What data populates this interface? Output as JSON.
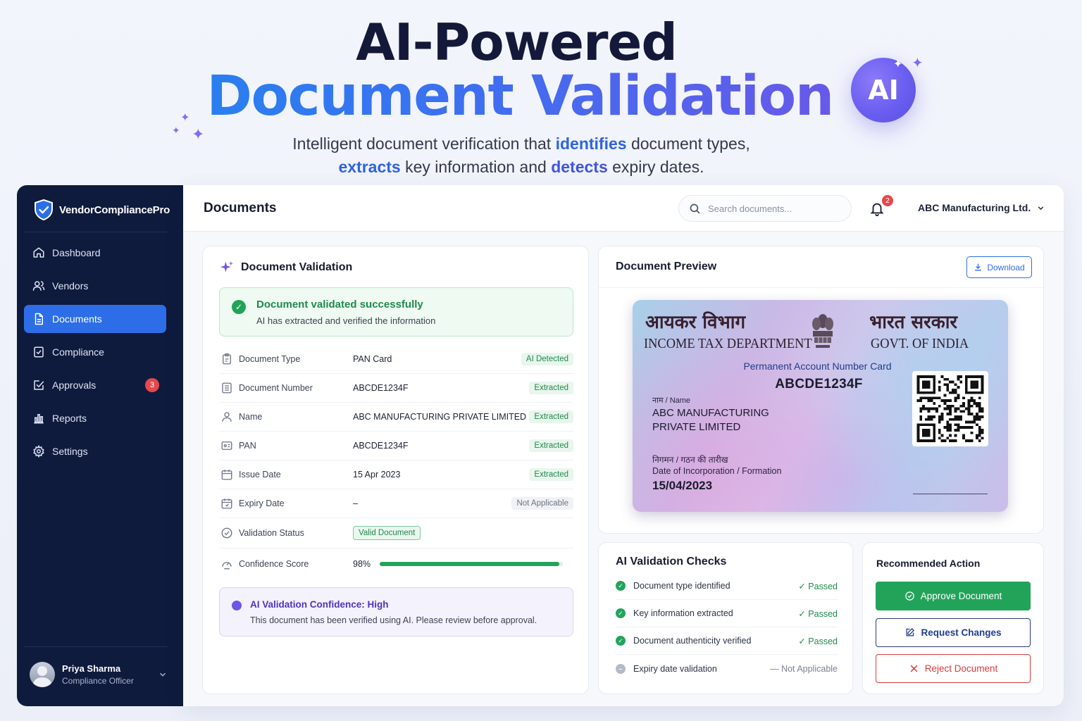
{
  "hero": {
    "title_line1": "AI-Powered",
    "title_line2": "Document Validation",
    "sub_1": "Intelligent document verification that ",
    "sub_hl1": "identifies",
    "sub_2": " document types,",
    "sub_hl2": "extracts",
    "sub_3": " key information and ",
    "sub_hl3": "detects",
    "sub_4": " expiry dates.",
    "ai_badge": "AI"
  },
  "sidebar": {
    "brand": "VendorCompliancePro",
    "items": [
      {
        "label": "Dashboard",
        "icon": "home-icon"
      },
      {
        "label": "Vendors",
        "icon": "users-icon"
      },
      {
        "label": "Documents",
        "icon": "document-icon",
        "active": true
      },
      {
        "label": "Compliance",
        "icon": "compliance-icon"
      },
      {
        "label": "Approvals",
        "icon": "approvals-icon",
        "badge": "3"
      },
      {
        "label": "Reports",
        "icon": "reports-icon"
      },
      {
        "label": "Settings",
        "icon": "gear-icon"
      }
    ],
    "user": {
      "name": "Priya Sharma",
      "role": "Compliance Officer"
    }
  },
  "topbar": {
    "title": "Documents",
    "search_placeholder": "Search documents...",
    "notifications": "2",
    "org": "ABC Manufacturing Ltd."
  },
  "validation": {
    "title": "Document Validation",
    "success_title": "Document validated successfully",
    "success_sub": "AI has extracted and verified the information",
    "rows": [
      {
        "label": "Document Type",
        "value": "PAN Card",
        "tag": "AI Detected"
      },
      {
        "label": "Document Number",
        "value": "ABCDE1234F",
        "tag": "Extracted"
      },
      {
        "label": "Name",
        "value": "ABC MANUFACTURING PRIVATE LIMITED",
        "tag": "Extracted"
      },
      {
        "label": "PAN",
        "value": "ABCDE1234F",
        "tag": "Extracted"
      },
      {
        "label": "Issue Date",
        "value": "15 Apr 2023",
        "tag": "Extracted"
      },
      {
        "label": "Expiry Date",
        "value": "–",
        "tag": "Not Applicable"
      }
    ],
    "status_label": "Validation Status",
    "status_value": "Valid Document",
    "confidence_label": "Confidence Score",
    "confidence_value": "98%",
    "confidence_fraction": 0.98,
    "note_title": "AI Validation Confidence: High",
    "note_sub": "This document has been verified using AI. Please review before approval."
  },
  "preview": {
    "title": "Document Preview",
    "download": "Download",
    "card": {
      "hindi_left": "आयकर विभाग",
      "eng_left": "INCOME TAX DEPARTMENT",
      "hindi_right": "भारत सरकार",
      "eng_right": "GOVT. OF INDIA",
      "subtitle": "Permanent Account Number Card",
      "number": "ABCDE1234F",
      "name_label": "नाम / Name",
      "name_1": "ABC MANUFACTURING",
      "name_2": "PRIVATE LIMITED",
      "date_label_hindi": "निगमन / गठन की तारीख",
      "date_label": "Date of Incorporation / Formation",
      "date": "15/04/2023"
    }
  },
  "checks": {
    "title": "AI Validation Checks",
    "items": [
      {
        "label": "Document type identified",
        "status": "✓ Passed",
        "ok": true
      },
      {
        "label": "Key information extracted",
        "status": "✓ Passed",
        "ok": true
      },
      {
        "label": "Document authenticity verified",
        "status": "✓ Passed",
        "ok": true
      },
      {
        "label": "Expiry date validation",
        "status": "— Not Applicable",
        "ok": false
      }
    ]
  },
  "actions": {
    "title": "Recommended Action",
    "approve": "Approve Document",
    "changes": "Request Changes",
    "reject": "Reject Document"
  },
  "colors": {
    "primary": "#2d6ee8",
    "success": "#22a35a",
    "danger": "#d93b3b",
    "sidebar": "#0f1b3d",
    "ai": "#6d55e6"
  }
}
